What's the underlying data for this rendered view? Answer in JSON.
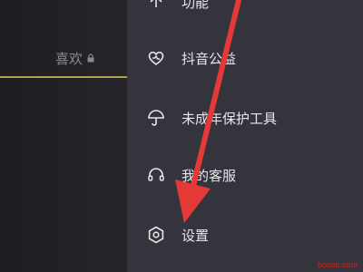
{
  "left_panel": {
    "tab_label": "喜欢",
    "accent_color": "#b2a04b"
  },
  "menu": {
    "items": [
      {
        "label": "功能",
        "icon": "feature-icon"
      },
      {
        "label": "抖音公益",
        "icon": "heart-hands-icon"
      },
      {
        "label": "未成年保护工具",
        "icon": "umbrella-icon"
      },
      {
        "label": "我的客服",
        "icon": "headset-icon"
      },
      {
        "label": "设置",
        "icon": "gear-hexagon-icon"
      }
    ]
  },
  "annotation": {
    "arrow_color": "#e53935"
  },
  "watermark": {
    "text": "booso.com"
  }
}
